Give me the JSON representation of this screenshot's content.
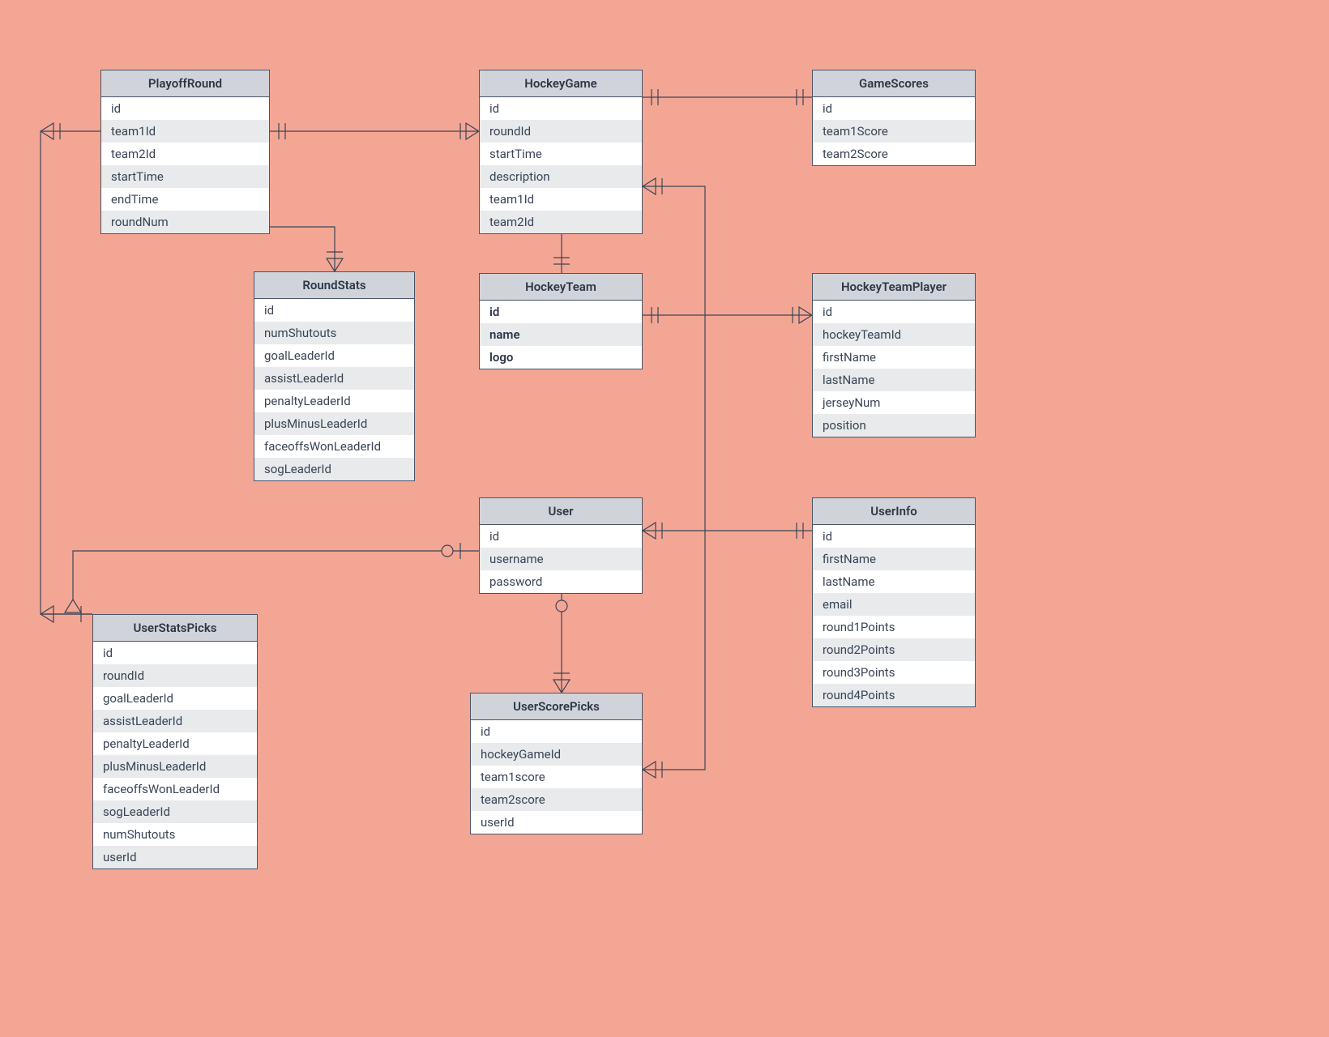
{
  "entities": {
    "playoffRound": {
      "title": "PlayoffRound",
      "fields": [
        "id",
        "team1Id",
        "team2Id",
        "startTime",
        "endTime",
        "roundNum"
      ]
    },
    "hockeyGame": {
      "title": "HockeyGame",
      "fields": [
        "id",
        "roundId",
        "startTime",
        "description",
        "team1Id",
        "team2Id"
      ]
    },
    "gameScores": {
      "title": "GameScores",
      "fields": [
        "id",
        "team1Score",
        "team2Score"
      ]
    },
    "roundStats": {
      "title": "RoundStats",
      "fields": [
        "id",
        "numShutouts",
        "goalLeaderId",
        "assistLeaderId",
        "penaltyLeaderId",
        "plusMinusLeaderId",
        "faceoffsWonLeaderId",
        "sogLeaderId"
      ]
    },
    "hockeyTeam": {
      "title": "HockeyTeam",
      "fields_bold": [
        "id",
        "name",
        "logo"
      ]
    },
    "hockeyTeamPlayer": {
      "title": "HockeyTeamPlayer",
      "fields": [
        "id",
        "hockeyTeamId",
        "firstName",
        "lastName",
        "jerseyNum",
        "position"
      ]
    },
    "user": {
      "title": "User",
      "fields": [
        "id",
        "username",
        "password"
      ]
    },
    "userInfo": {
      "title": "UserInfo",
      "fields": [
        "id",
        "firstName",
        "lastName",
        "email",
        "round1Points",
        "round2Points",
        "round3Points",
        "round4Points"
      ]
    },
    "userStatsPicks": {
      "title": "UserStatsPicks",
      "fields": [
        "id",
        "roundId",
        "goalLeaderId",
        "assistLeaderId",
        "penaltyLeaderId",
        "plusMinusLeaderId",
        "faceoffsWonLeaderId",
        "sogLeaderId",
        "numShutouts",
        "userId"
      ]
    },
    "userScorePicks": {
      "title": "UserScorePicks",
      "fields": [
        "id",
        "hockeyGameId",
        "team1score",
        "team2score",
        "userId"
      ]
    }
  }
}
